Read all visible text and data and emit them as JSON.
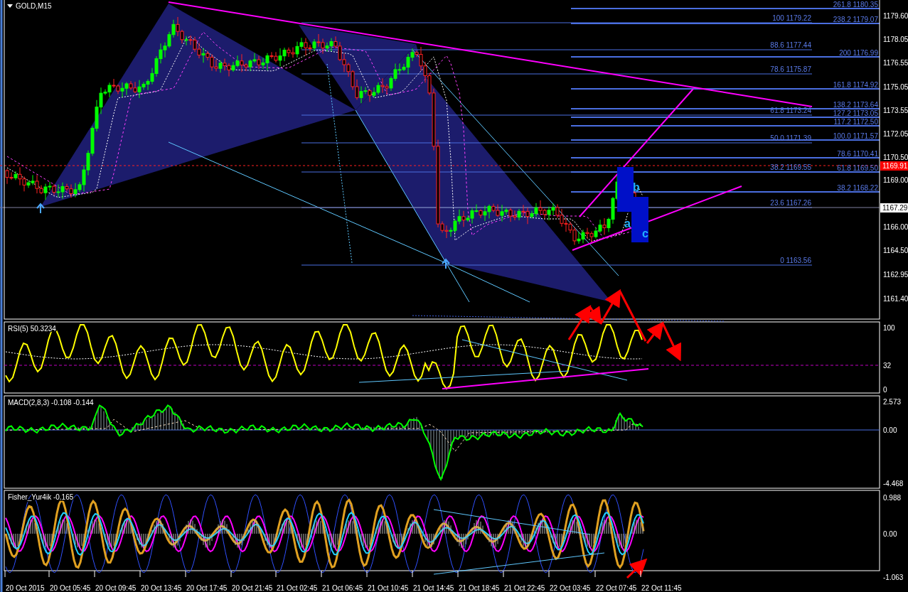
{
  "chart": {
    "title": "GOLD,M15",
    "price_axis": [
      "1179.60",
      "1178.05",
      "1176.55",
      "1175.05",
      "1173.55",
      "1172.05",
      "1170.50",
      "1169.00",
      "1166.00",
      "1164.50",
      "1162.95",
      "1161.40"
    ],
    "price_tags": [
      {
        "text": "1169.91",
        "kind": "bid"
      },
      {
        "text": "1167.29",
        "kind": "last"
      }
    ],
    "fib_left": [
      "100 1179.22",
      "88.6 1177.44",
      "78.6 1175.87",
      "61.8 1173.24",
      "50.0 1171.39",
      "38.2 1169.55",
      "23.6 1167.26",
      "0 1163.56"
    ],
    "fib_right": [
      "261.8 1180.35",
      "238.2 1179.07",
      "200 1176.99",
      "161.8 1174.92",
      "138.2 1173.64",
      "127.2 1173.05",
      "117.2 1172.50",
      "100.0  1171.57",
      "78.6 1170.41",
      "61.8 1169.50",
      "38.2 1168.22"
    ],
    "wave_labels": [
      "a",
      "b",
      "c"
    ]
  },
  "rsi": {
    "title": "RSI(5) 50.3234",
    "axis": [
      "100",
      "32",
      "0"
    ]
  },
  "macd": {
    "title": "MACD(2,8,3) -0.108 -0.144",
    "axis": [
      "2.573",
      "0.00",
      "-4.468"
    ]
  },
  "fisher": {
    "title": "Fisher_Yur4ik -0.165",
    "axis": [
      "0.988",
      "0.00",
      "-1.063"
    ]
  },
  "time_axis": [
    "20 Oct 2015",
    "20 Oct 05:45",
    "20 Oct 09:45",
    "20 Oct 13:45",
    "20 Oct 17:45",
    "20 Oct 21:45",
    "21 Oct 02:45",
    "21 Oct 06:45",
    "21 Oct 10:45",
    "21 Oct 14:45",
    "21 Oct 18:45",
    "21 Oct 22:45",
    "22 Oct 03:45",
    "22 Oct 07:45",
    "22 Oct 11:45"
  ]
}
